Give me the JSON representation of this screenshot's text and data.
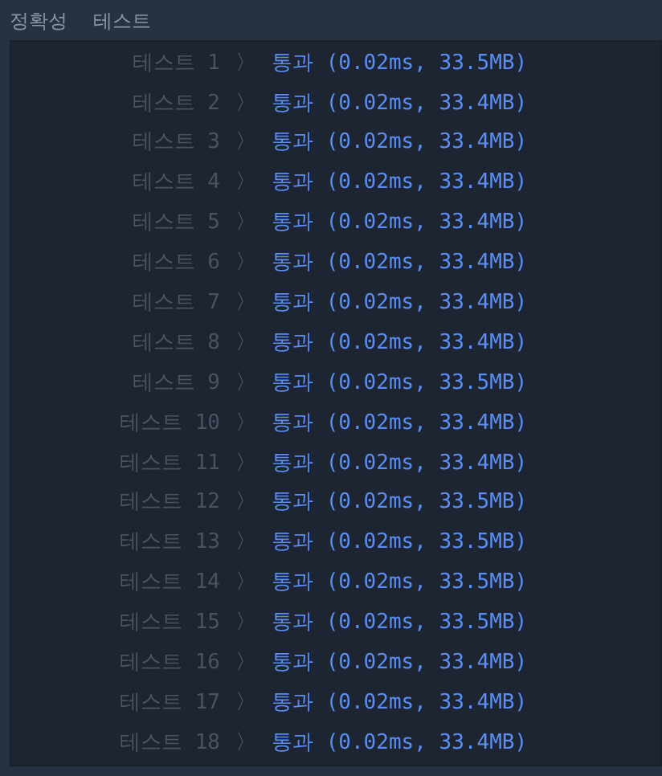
{
  "header": {
    "title": "정확성",
    "subtitle": "테스트"
  },
  "results": [
    {
      "label": "테스트 1",
      "separator": "〉",
      "result": "통과 (0.02ms, 33.5MB)"
    },
    {
      "label": "테스트 2",
      "separator": "〉",
      "result": "통과 (0.02ms, 33.4MB)"
    },
    {
      "label": "테스트 3",
      "separator": "〉",
      "result": "통과 (0.02ms, 33.4MB)"
    },
    {
      "label": "테스트 4",
      "separator": "〉",
      "result": "통과 (0.02ms, 33.4MB)"
    },
    {
      "label": "테스트 5",
      "separator": "〉",
      "result": "통과 (0.02ms, 33.4MB)"
    },
    {
      "label": "테스트 6",
      "separator": "〉",
      "result": "통과 (0.02ms, 33.4MB)"
    },
    {
      "label": "테스트 7",
      "separator": "〉",
      "result": "통과 (0.02ms, 33.4MB)"
    },
    {
      "label": "테스트 8",
      "separator": "〉",
      "result": "통과 (0.02ms, 33.4MB)"
    },
    {
      "label": "테스트 9",
      "separator": "〉",
      "result": "통과 (0.02ms, 33.5MB)"
    },
    {
      "label": "테스트 10",
      "separator": "〉",
      "result": "통과 (0.02ms, 33.4MB)"
    },
    {
      "label": "테스트 11",
      "separator": "〉",
      "result": "통과 (0.02ms, 33.4MB)"
    },
    {
      "label": "테스트 12",
      "separator": "〉",
      "result": "통과 (0.02ms, 33.5MB)"
    },
    {
      "label": "테스트 13",
      "separator": "〉",
      "result": "통과 (0.02ms, 33.5MB)"
    },
    {
      "label": "테스트 14",
      "separator": "〉",
      "result": "통과 (0.02ms, 33.5MB)"
    },
    {
      "label": "테스트 15",
      "separator": "〉",
      "result": "통과 (0.02ms, 33.5MB)"
    },
    {
      "label": "테스트 16",
      "separator": "〉",
      "result": "통과 (0.02ms, 33.4MB)"
    },
    {
      "label": "테스트 17",
      "separator": "〉",
      "result": "통과 (0.02ms, 33.4MB)"
    },
    {
      "label": "테스트 18",
      "separator": "〉",
      "result": "통과 (0.02ms, 33.4MB)"
    }
  ]
}
